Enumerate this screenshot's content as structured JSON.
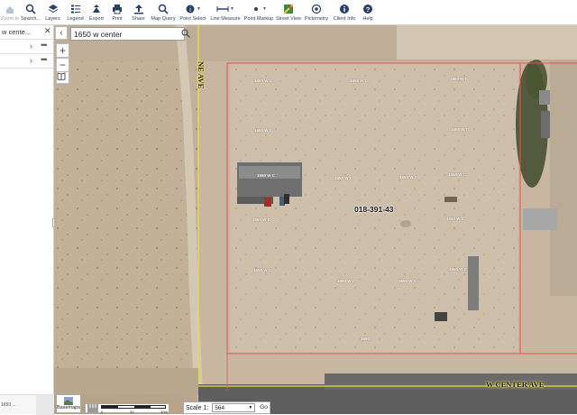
{
  "toolbar": {
    "items": [
      {
        "label": "Zoom to Extent",
        "icon": "home-icon"
      },
      {
        "label": "Search...",
        "icon": "search-icon"
      },
      {
        "label": "Layers",
        "icon": "layers-icon"
      },
      {
        "label": "Legend",
        "icon": "legend-icon"
      },
      {
        "label": "Export",
        "icon": "export-icon"
      },
      {
        "label": "Print",
        "icon": "print-icon"
      },
      {
        "label": "Share",
        "icon": "share-icon"
      },
      {
        "label": "Map Query",
        "icon": "map-query-icon"
      },
      {
        "label": "Point Select",
        "icon": "point-select-icon"
      },
      {
        "label": "Line Measure",
        "icon": "line-measure-icon"
      },
      {
        "label": "Point Markup",
        "icon": "point-markup-icon"
      },
      {
        "label": "Street View",
        "icon": "street-view-icon"
      },
      {
        "label": "Pictometry",
        "icon": "pictometry-icon"
      },
      {
        "label": "Client Info",
        "icon": "info-icon"
      },
      {
        "label": "Help",
        "icon": "help-icon"
      }
    ]
  },
  "left_panel": {
    "search_result": "w cente...",
    "rows": [
      "",
      ""
    ],
    "bottom_text": "1650 ..."
  },
  "search": {
    "value": "1650 w center"
  },
  "map": {
    "apn": "018-391-43",
    "streets": {
      "ne": "NE AVE",
      "w_center": "W CENTER AVE"
    },
    "labels": [
      {
        "text": "1650 W C"
      },
      {
        "text": "1650 W C"
      },
      {
        "text": "1650 W C"
      },
      {
        "text": "1650 W C"
      },
      {
        "text": "1650 W C"
      },
      {
        "text": "1650 W C"
      },
      {
        "text": "1650 W C"
      },
      {
        "text": "1650 W C"
      },
      {
        "text": "1650 W C"
      },
      {
        "text": "1650 W C"
      },
      {
        "text": "1650 W C"
      },
      {
        "text": "1650 W C"
      },
      {
        "text": "1650 W C"
      },
      {
        "text": "1650 W C"
      },
      {
        "text": "1650 W C"
      },
      {
        "text": "1650"
      }
    ],
    "colors": {
      "parcel": "#e05555",
      "road": "#e8e038"
    }
  },
  "scalebar": {
    "basemaps_label": "Basemaps",
    "ticks": [
      "0",
      "20",
      "40m"
    ],
    "scale_label": "Scale 1:",
    "scale_value": "564",
    "go_label": "Go"
  }
}
